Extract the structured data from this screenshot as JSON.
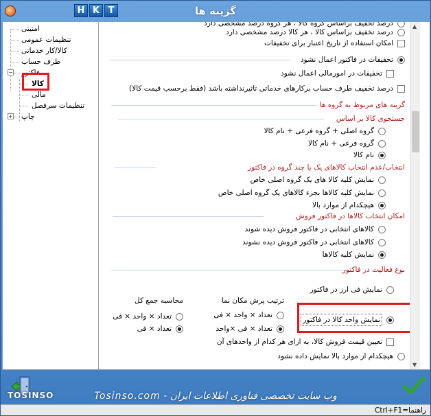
{
  "window": {
    "title": "گزینه ها",
    "hkt_buttons": [
      "H",
      "K",
      "T"
    ]
  },
  "tree": {
    "items": [
      {
        "label": "امنیتی"
      },
      {
        "label": "تنظیمات عمومی"
      },
      {
        "label": "کالا/کار خدماتی"
      },
      {
        "label": "طرف حساب"
      },
      {
        "label": "فاکتور"
      },
      {
        "label": "کالا"
      },
      {
        "label": "مالی"
      },
      {
        "label": "تنظیمات سرفصل"
      },
      {
        "label": "چاپ"
      }
    ]
  },
  "options": {
    "partial_top": "درصد تخفیف براساس گروه کالا ، هر گروه درصد مشخصی دارد",
    "discount_per_item": "درصد تخفیف براساس کالا ، هر کالا درصد مشخصی دارد",
    "discount_date_validity": "امکان استفاده از تاریخ اعتبار برای تخفیفات",
    "apply_discounts": "تخفیفات در فاکتور اعمال نشود",
    "no_discount_ops": "تخفیفات در امورمالی اعمال نشود",
    "service_discount": "درصد تخفیف طرف حساب برکارهای خدماتی تاثیرنداشته باشد (فقط برحسب قیمت کالا)"
  },
  "group_options_title": "گزینه های مربوط به گروه ها",
  "search": {
    "title": "جستجوی کالا بر اساس",
    "options": [
      "گروه اصلی + گروه فرعی + نام کالا",
      "گروه فرعی + نام کالا",
      "نام کالا"
    ]
  },
  "select": {
    "title": "انتخاب/عدم انتخاب کالاهای یک یا چند گروه در فاکتور",
    "options": [
      "نمایش کلیه کالا های یک گروه اصلی خاص",
      "نمایش کلیه کالاها بجزء کالاهای یک گروه اصلی خاص",
      "هیچکدام از موارد بالا"
    ]
  },
  "sale": {
    "title": "امکان انتخاب کالاها در فاکتور فروش",
    "options": [
      "کالاهای انتخابی در فاکتور فروش دیده شوند",
      "کالاهای انتخابی در فاکتور فروش دیده نشوند",
      "نمایش کلیه کالاها"
    ]
  },
  "activity": {
    "title": "نوع فعالیت در فاکتور",
    "show_price": "نمایش فی ارز در فاکتور",
    "show_unit": "نمایش واحد کالا در فاکتور",
    "unit_price": "تعیین قیمت فروش کالا، به ازای هر کدام از واحدهای آن",
    "none": "هیچکدام از موارد بالا نمایش داده نشود",
    "place_title": "ترتیب پرش مکان نما",
    "place_options": [
      "تعداد × واحد × فی",
      "تعداد × فی ×واحد"
    ],
    "total_title": "محاسبه جمع کل",
    "total_options": [
      "تعداد × واحد × فی",
      "تعداد × فی"
    ]
  },
  "watermark": "وب سایت تخصصی فناوری اطلاعات ایران - Tosinso.com",
  "watermark_logo": "TOSINSO",
  "statusbar": {
    "text": "راهنما=Ctrl+F1"
  }
}
